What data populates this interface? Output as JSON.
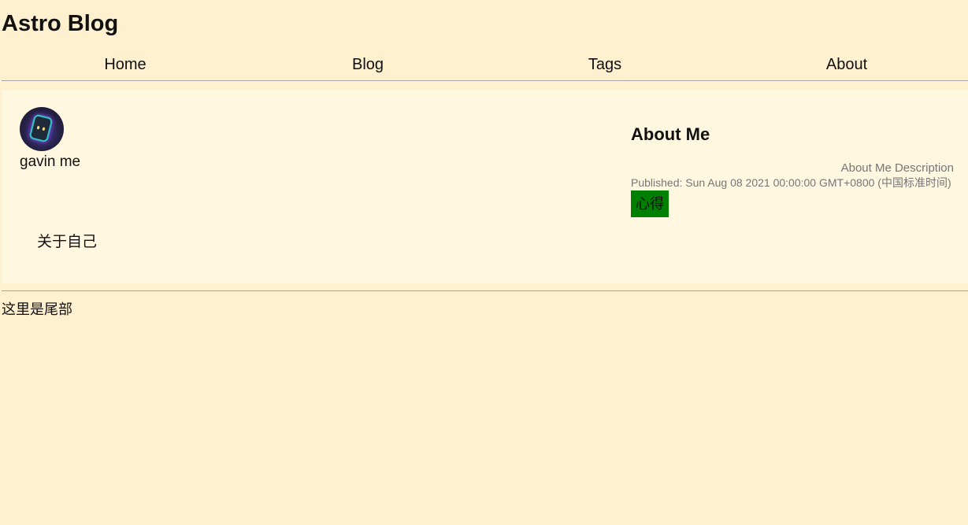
{
  "header": {
    "site_title": "Astro Blog"
  },
  "nav": {
    "items": [
      {
        "label": "Home"
      },
      {
        "label": "Blog"
      },
      {
        "label": "Tags"
      },
      {
        "label": "About"
      }
    ]
  },
  "author": {
    "avatar_icon": "avatar-image",
    "name": "gavin me"
  },
  "post": {
    "title": "About Me",
    "description": "About Me Description",
    "published": "Published: Sun Aug 08 2021 00:00:00 GMT+0800 (中国标准时间)",
    "tag": "心得",
    "content": "关于自己"
  },
  "footer": {
    "text": "这里是尾部"
  },
  "colors": {
    "background": "#fff0cf",
    "card_background": "#fff7e0",
    "tag_background": "#008000",
    "muted_text": "#767676",
    "divider": "#a8a8a8"
  }
}
